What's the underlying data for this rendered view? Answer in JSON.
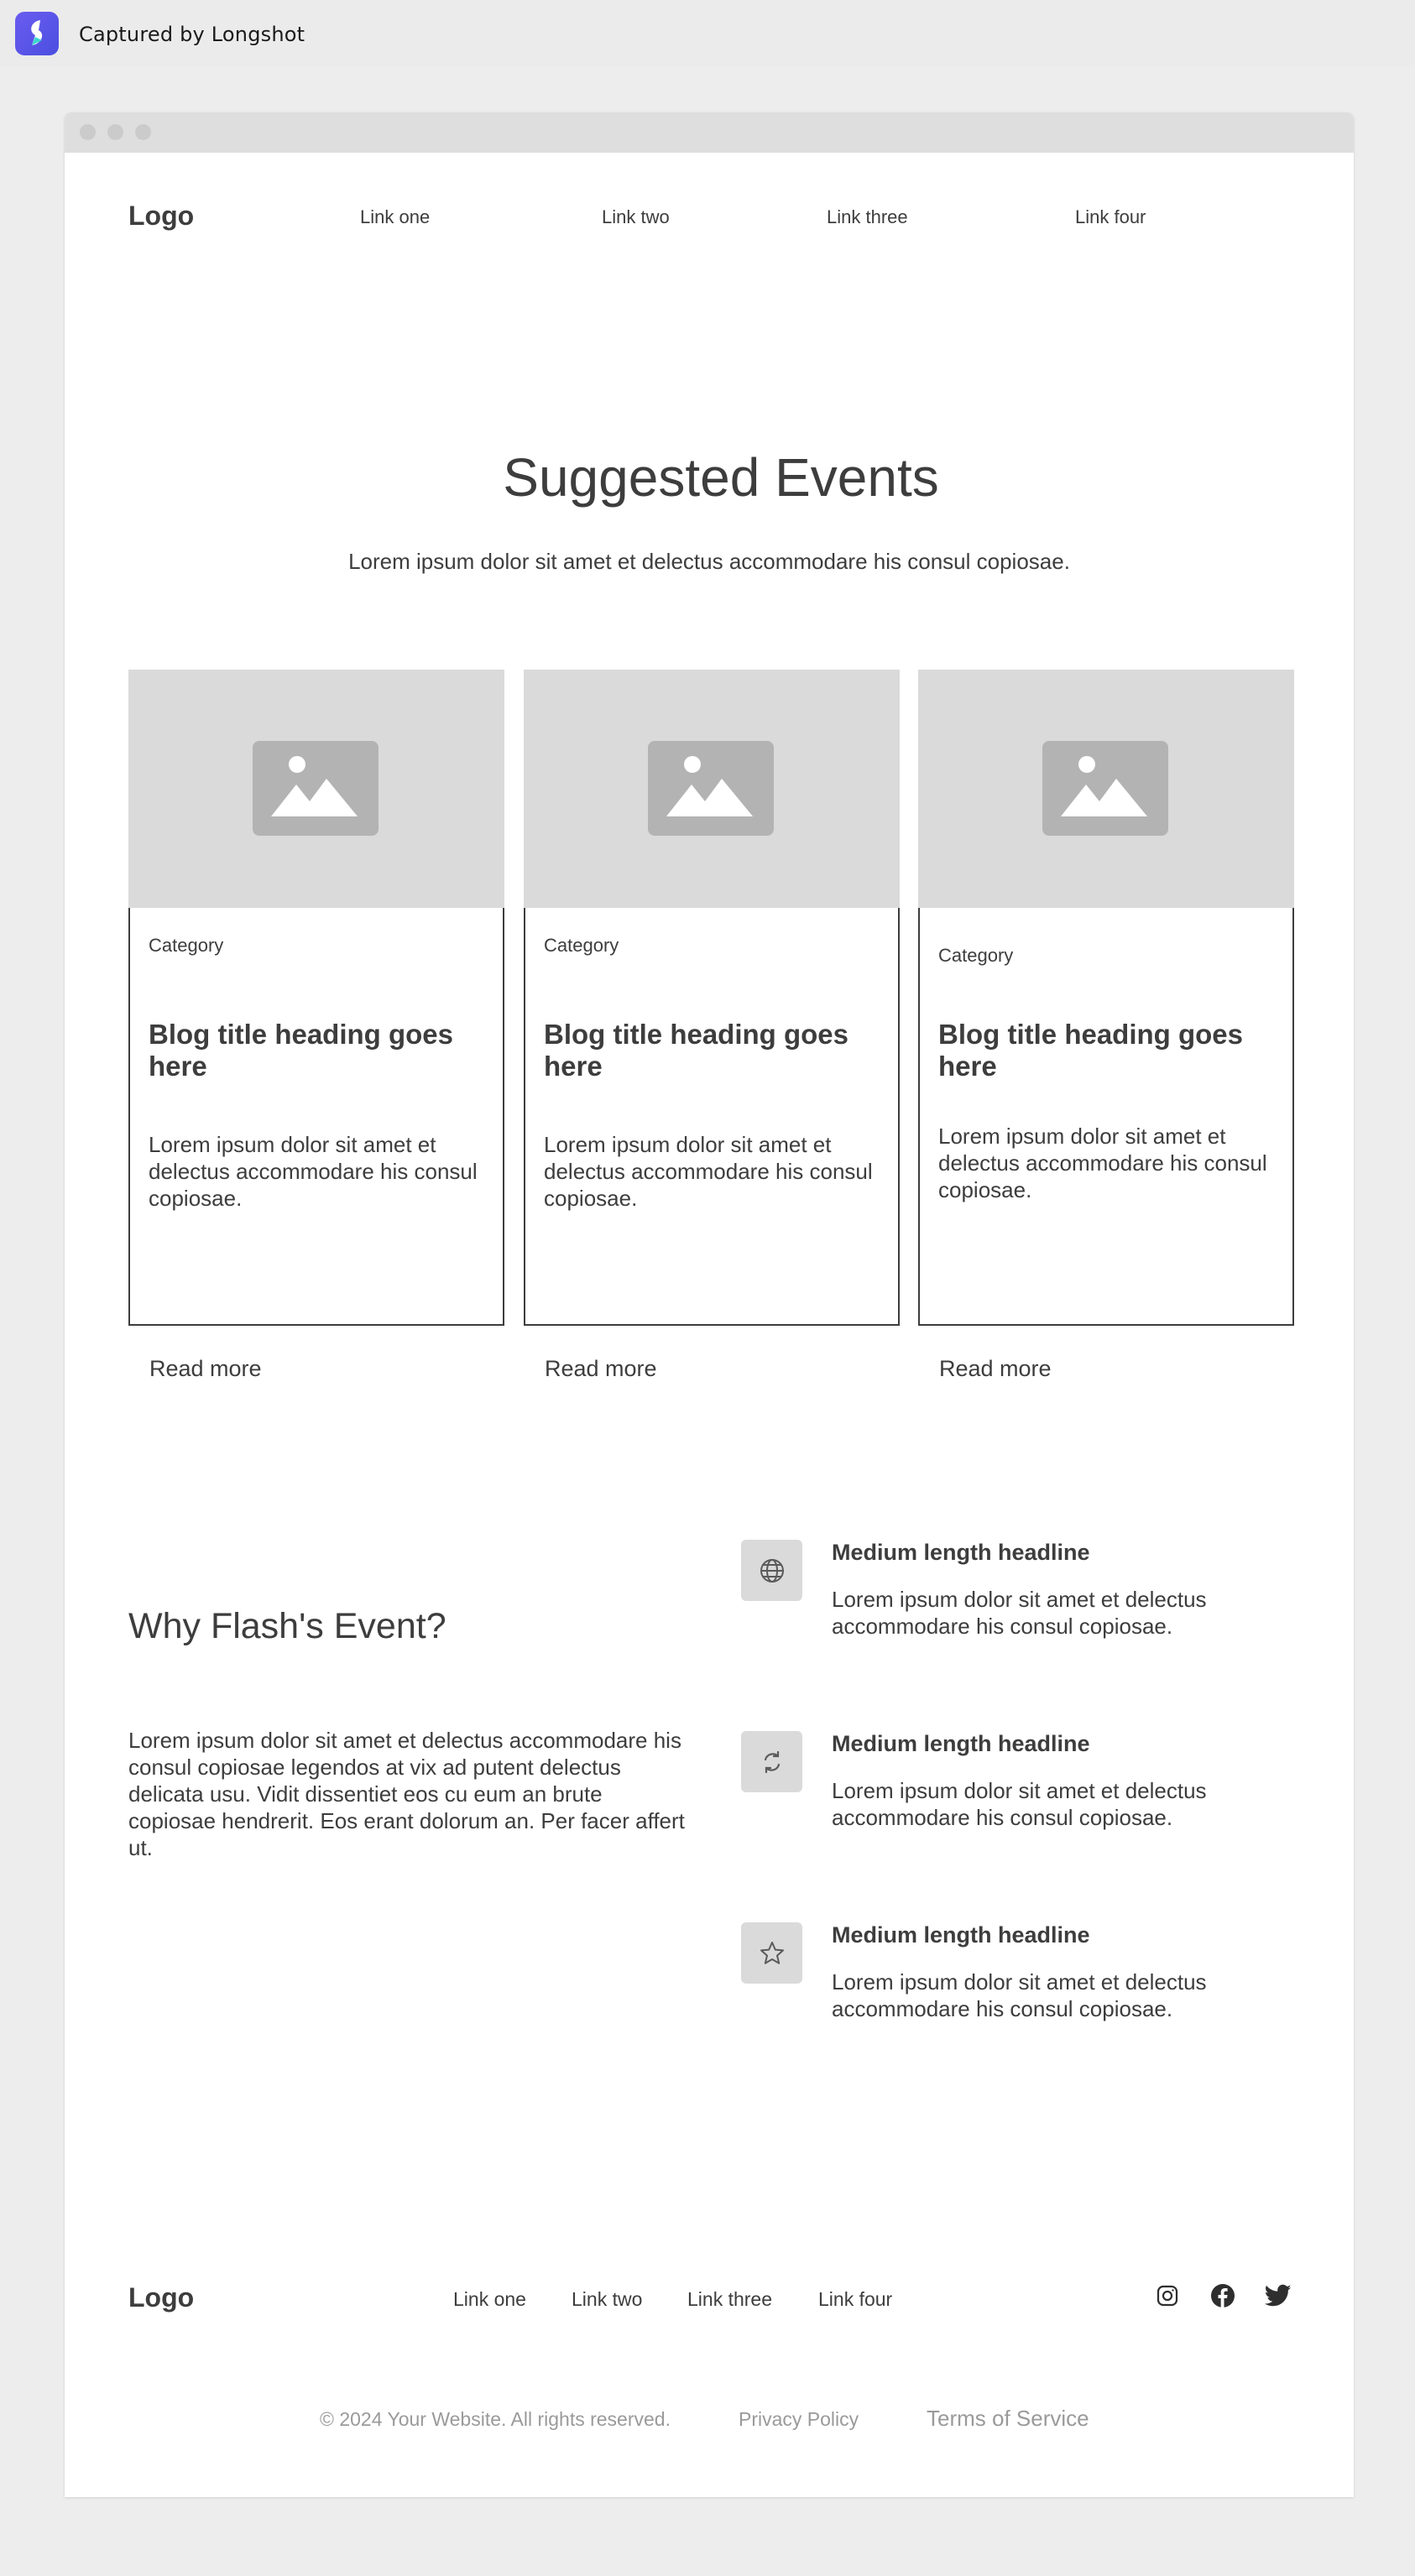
{
  "capture": {
    "text": "Captured by Longshot",
    "brand_color": "#5b52ea",
    "icon": "longshot-logo-icon"
  },
  "nav": {
    "logo": "Logo",
    "links": [
      "Link one",
      "Link two",
      "Link three",
      "Link four"
    ]
  },
  "hero": {
    "title": "Suggested Events",
    "subtitle": "Lorem ipsum dolor sit amet et delectus accommodare his consul copiosae."
  },
  "cards": [
    {
      "category": "Category",
      "title": "Blog title heading goes here",
      "body": "Lorem ipsum dolor sit amet et delectus accommodare his consul copiosae.",
      "read_more": "Read more",
      "image_icon": "image-placeholder-icon"
    },
    {
      "category": "Category",
      "title": "Blog title heading goes here",
      "body": "Lorem ipsum dolor sit amet et delectus accommodare his consul copiosae.",
      "read_more": "Read more",
      "image_icon": "image-placeholder-icon"
    },
    {
      "category": "Category",
      "title": "Blog title heading goes here",
      "body": "Lorem ipsum dolor sit amet et delectus accommodare his consul copiosae.",
      "read_more": "Read more",
      "image_icon": "image-placeholder-icon"
    }
  ],
  "why": {
    "title": "Why Flash's Event?",
    "body": "Lorem ipsum dolor sit amet et delectus accommodare his consul copiosae legendos at vix ad putent delectus delicata usu. Vidit dissentiet eos cu eum an brute copiosae hendrerit. Eos erant dolorum an. Per facer affert ut."
  },
  "features": [
    {
      "icon": "globe-icon",
      "headline": "Medium length headline",
      "body": "Lorem ipsum dolor sit amet et delectus accommodare his consul copiosae."
    },
    {
      "icon": "refresh-icon",
      "headline": "Medium length headline",
      "body": "Lorem ipsum dolor sit amet et delectus accommodare his consul copiosae."
    },
    {
      "icon": "star-icon",
      "headline": "Medium length headline",
      "body": "Lorem ipsum dolor sit amet et delectus accommodare his consul copiosae."
    }
  ],
  "footer": {
    "logo": "Logo",
    "links": [
      "Link one",
      "Link two",
      "Link three",
      "Link four"
    ],
    "social_icons": [
      "instagram-icon",
      "facebook-icon",
      "twitter-icon"
    ],
    "copyright": "© 2024 Your Website. All rights reserved.",
    "privacy": "Privacy Policy",
    "terms": "Terms of Service"
  }
}
